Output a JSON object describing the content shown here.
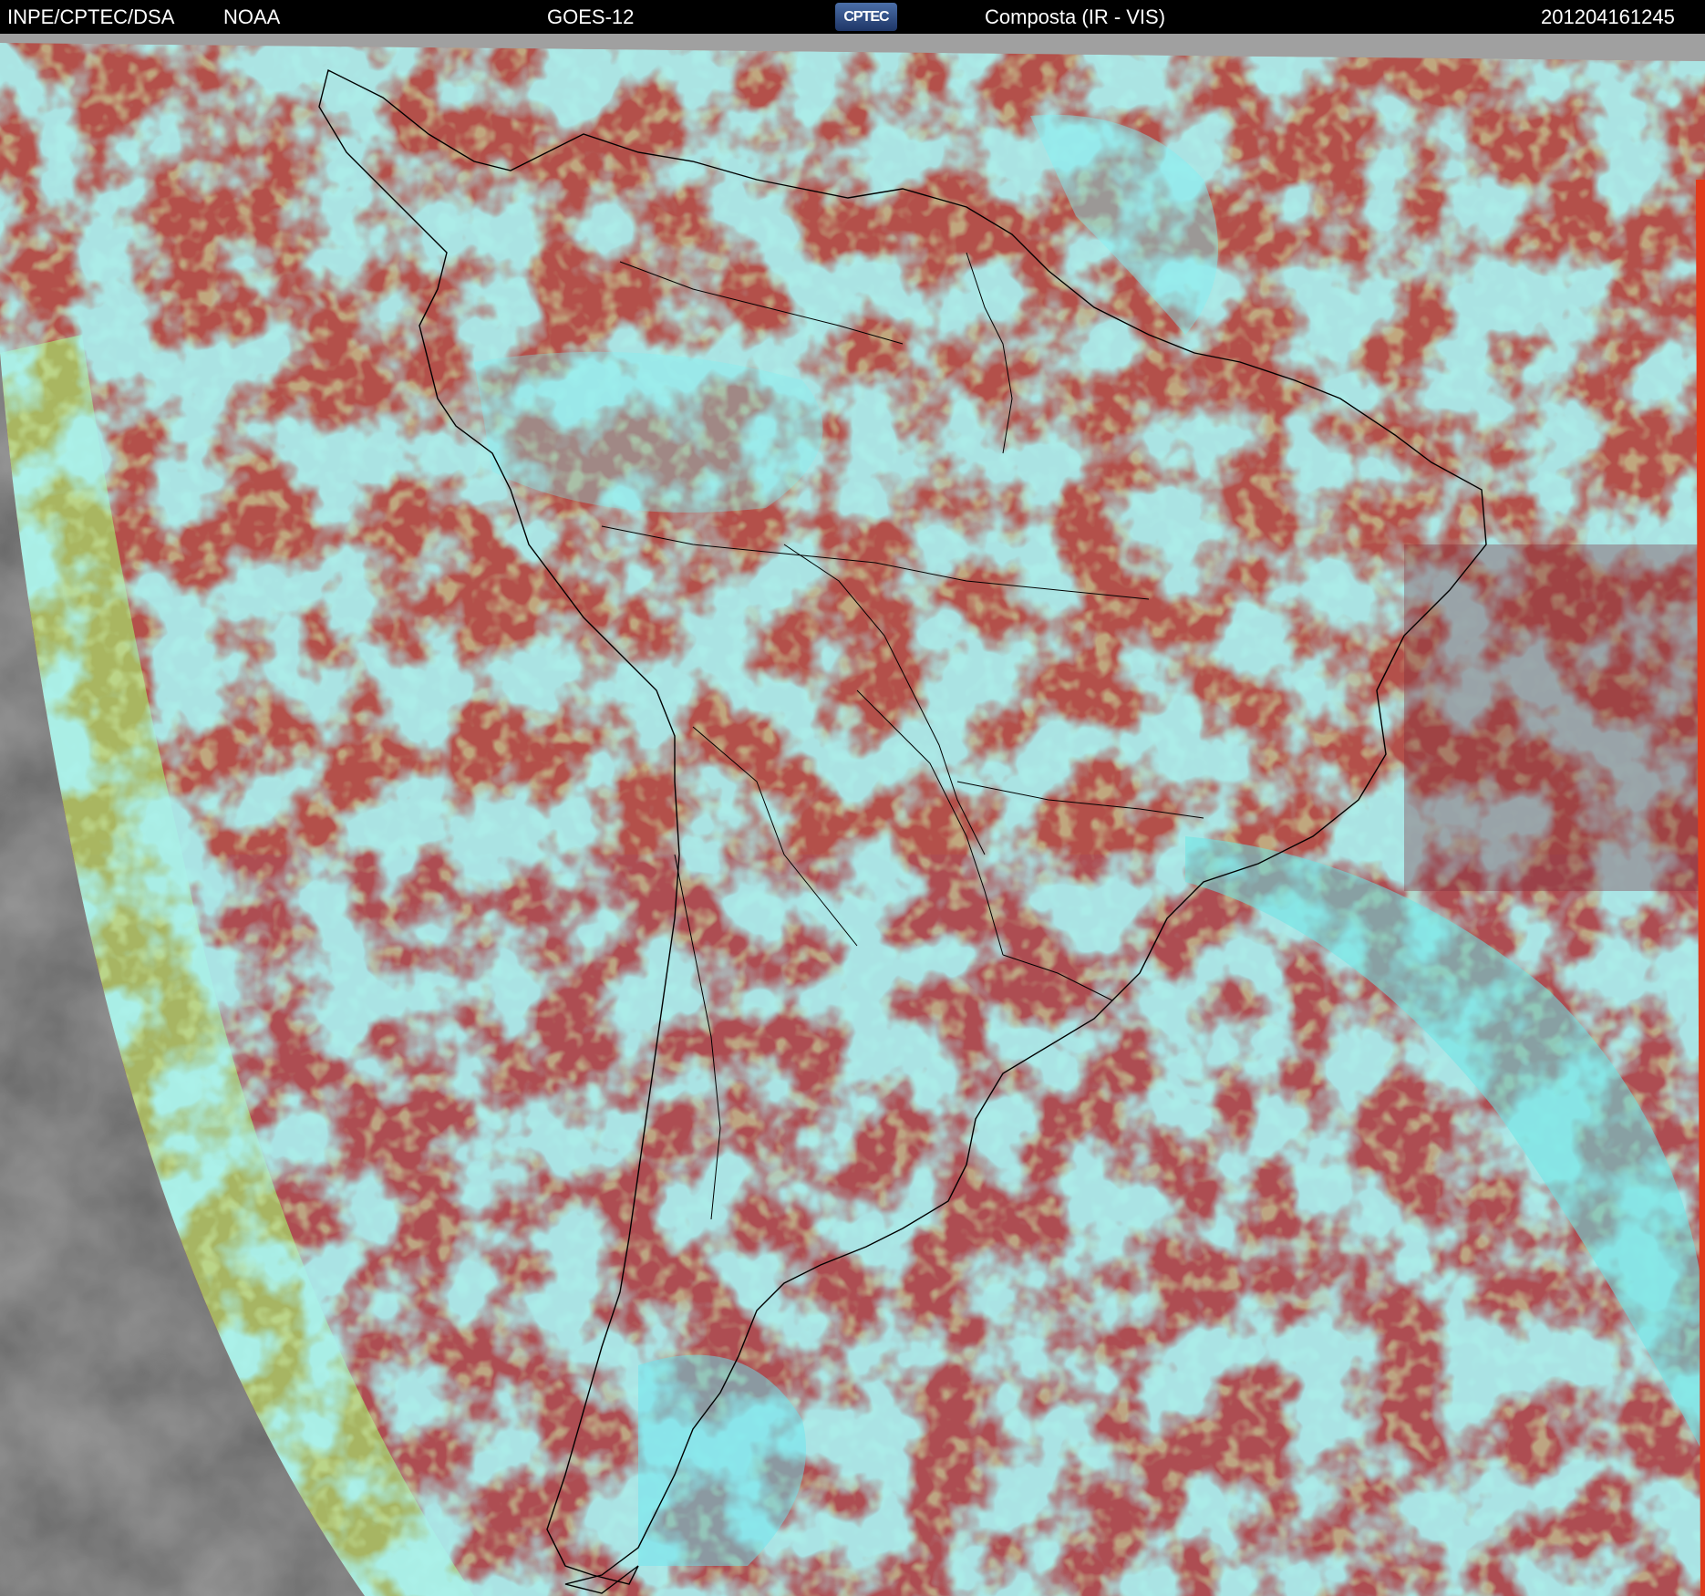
{
  "header": {
    "source": "INPE/CPTEC/DSA",
    "agency": "NOAA",
    "satellite": "GOES-12",
    "logo": "CPTEC",
    "product": "Composta (IR - VIS)",
    "timestamp": "201204161245"
  },
  "colors": {
    "header_background": "#000000",
    "ocean_clear": "#b84f45",
    "deep_cloud": "#5ce8f0",
    "low_cloud": "#9fd860",
    "night_side": "#404040",
    "coastline": "#000000"
  }
}
